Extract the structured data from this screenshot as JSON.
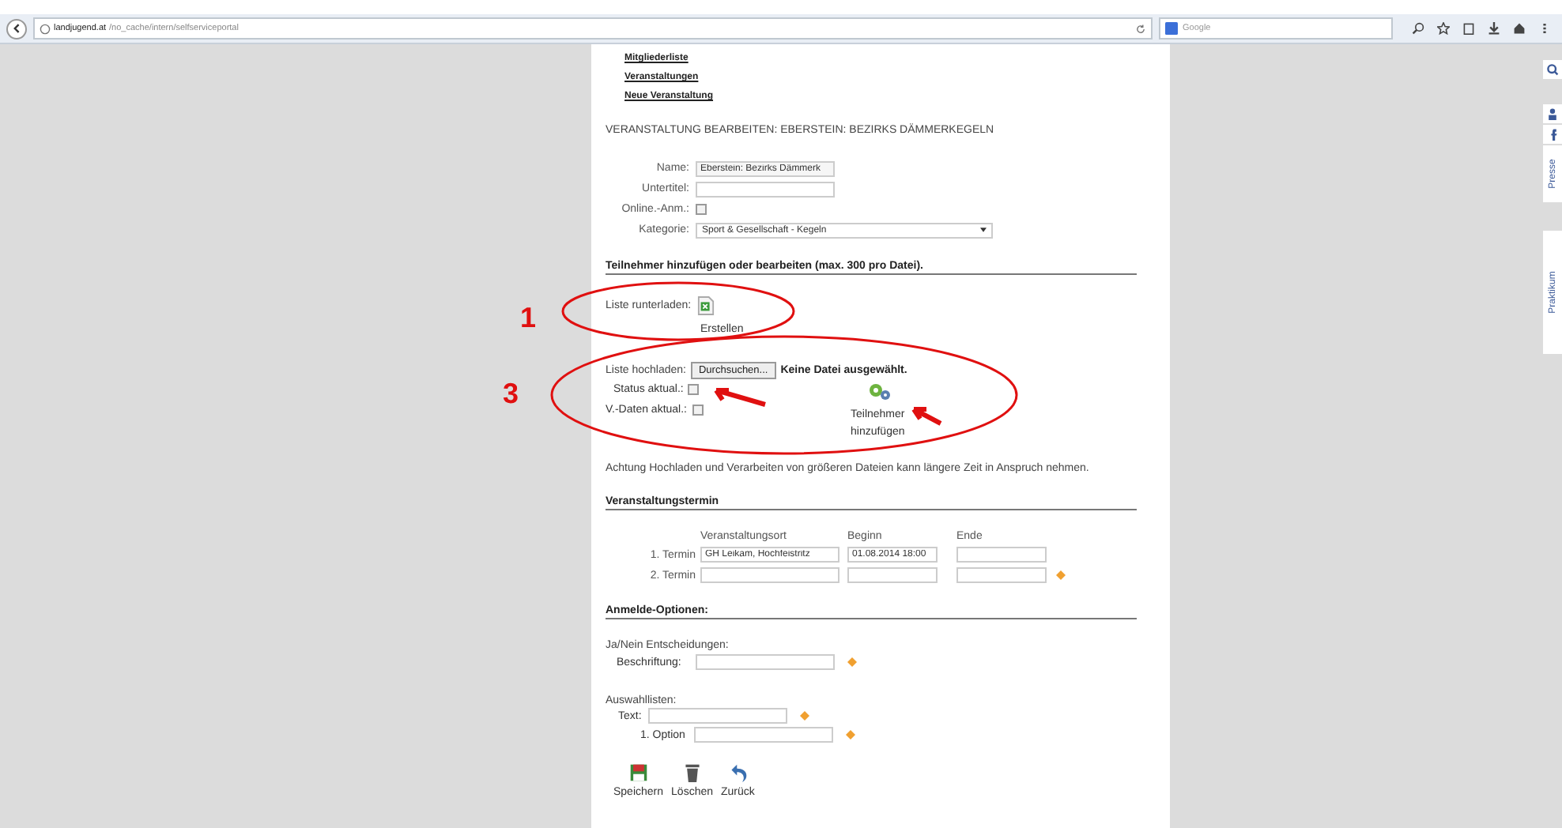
{
  "browser": {
    "url_host": "landjugend.at",
    "url_path": "/no_cache/intern/selfserviceportal",
    "search_placeholder": "Google"
  },
  "nav_links": [
    "Mitgliederliste",
    "Veranstaltungen",
    "Neue Veranstaltung"
  ],
  "page_title": "VERANSTALTUNG BEARBEITEN: EBERSTEIN: BEZIRKS DÄMMERKEGELN",
  "form": [
    {
      "kind": "text",
      "label": "Name:",
      "value": "Eberstein: Bezirks Dämmerk"
    },
    {
      "kind": "text",
      "label": "Untertitel:"
    },
    {
      "kind": "checkbox",
      "label": "Online.-Anm.:",
      "checked": false
    },
    {
      "kind": "select",
      "label": "Kategorie:",
      "value": "Sport & Gesellschaft - Kegeln"
    }
  ],
  "participants": {
    "heading": "Teilnehmer hinzufügen oder bearbeiten (max. 300 pro Datei).",
    "download_label": "Liste runterladen:",
    "create_label": "Erstellen",
    "upload_label": "Liste hochladen:",
    "browse_button": "Durchsuchen...",
    "no_file": "Keine Datei ausgewählt.",
    "options": [
      {
        "label": "Status aktual.:",
        "checked": false
      },
      {
        "label": "V.-Daten aktual.:",
        "checked": false
      }
    ],
    "add_label": "Teilnehmer hinzufügen",
    "note": "Achtung Hochladen und Verarbeiten von größeren Dateien kann längere Zeit in Anspruch nehmen."
  },
  "dates": {
    "heading": "Veranstaltungstermin",
    "columns": [
      "Veranstaltungsort",
      "Beginn",
      "Ende"
    ],
    "rows": [
      {
        "label": "1. Termin",
        "place": "GH Leikam, Hochfeistritz",
        "start": "01.08.2014 18:00"
      },
      {
        "label": "2. Termin"
      }
    ]
  },
  "options": {
    "heading": "Anmelde-Optionen:",
    "yesno_label": "Ja/Nein Entscheidungen:",
    "caption_label": "Beschriftung:",
    "lists_label": "Auswahllisten:",
    "text_label": "Text:",
    "option_label": "1. Option"
  },
  "actions": [
    {
      "kind": "save",
      "label": "Speichern"
    },
    {
      "kind": "delete",
      "label": "Löschen"
    },
    {
      "kind": "back",
      "label": "Zurück"
    }
  ],
  "side_tabs": [
    "Presse",
    "Praktikum"
  ],
  "annotations": [
    "1",
    "3"
  ]
}
